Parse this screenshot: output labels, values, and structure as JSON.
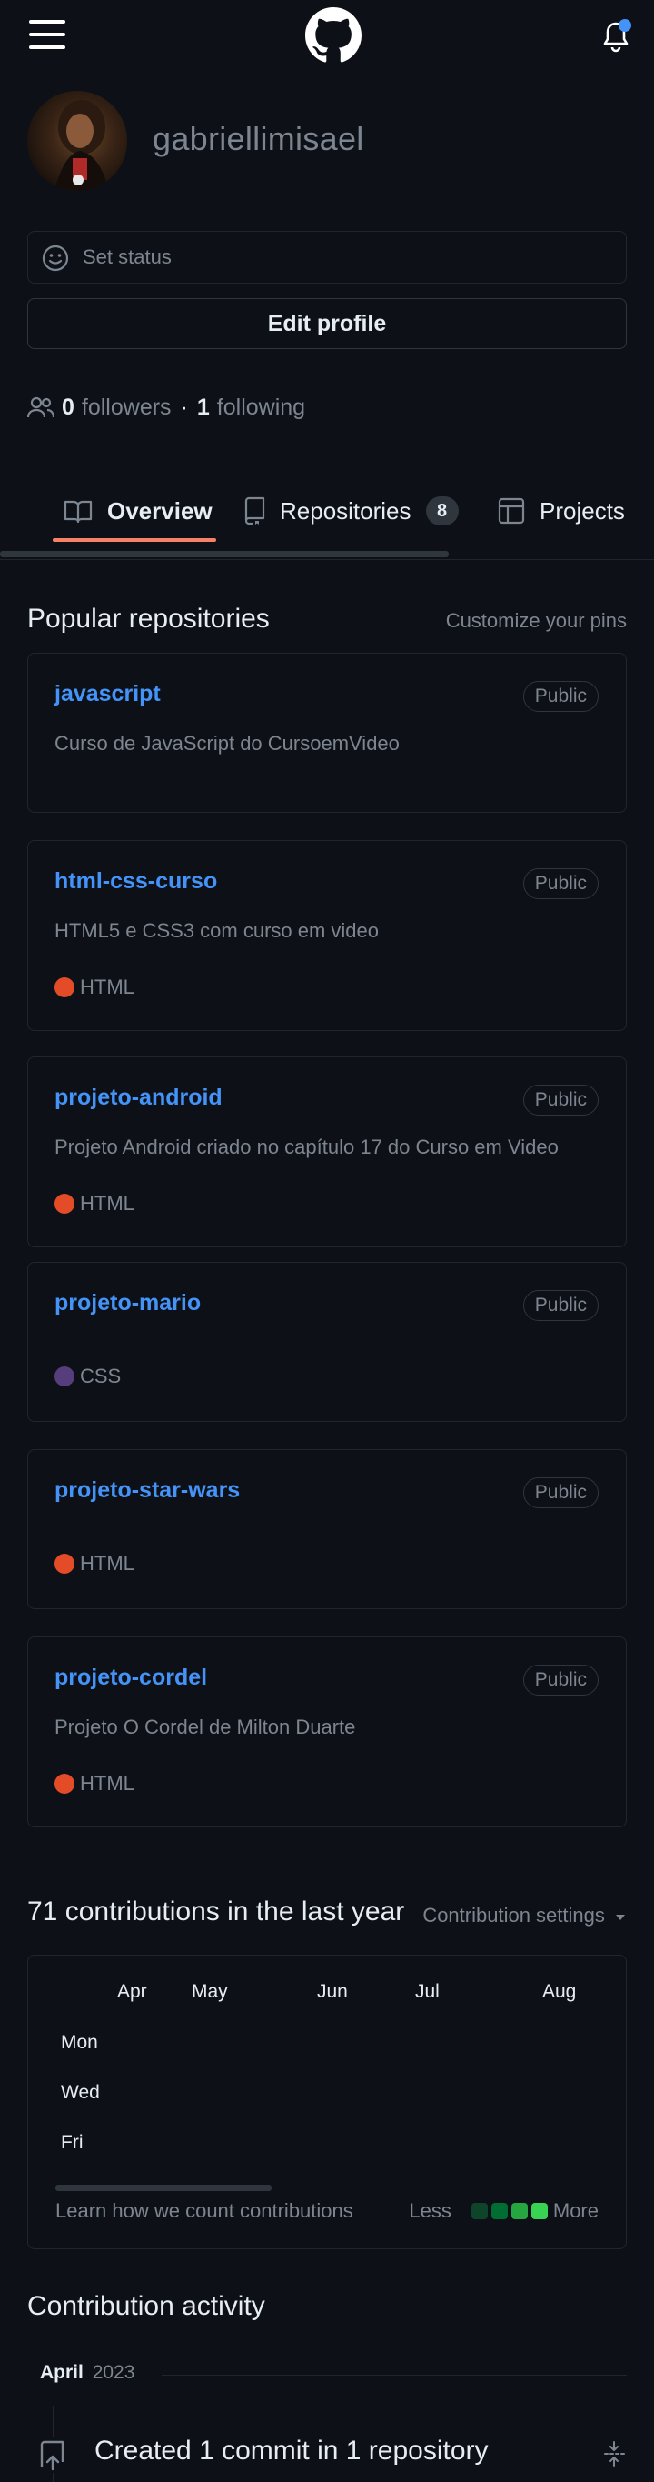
{
  "header": {
    "menu_icon": "hamburger-icon",
    "logo_icon": "github-octocat-icon",
    "notification_icon": "bell-icon",
    "notification_dot_color": "#4493f8"
  },
  "profile": {
    "username": "gabriellimisael",
    "status_placeholder": "Set status",
    "edit_button": "Edit profile",
    "followers_count": "0",
    "followers_label": "followers",
    "separator": "·",
    "following_count": "1",
    "following_label": "following"
  },
  "tabs": [
    {
      "label": "Overview",
      "icon": "book-icon",
      "selected": true
    },
    {
      "label": "Repositories",
      "icon": "repo-icon",
      "count": "8"
    },
    {
      "label": "Projects",
      "icon": "table-icon"
    }
  ],
  "popular": {
    "title": "Popular repositories",
    "customize": "Customize your pins",
    "repos": [
      {
        "name": "javascript",
        "visibility": "Public",
        "description": "Curso de JavaScript do CursoemVideo",
        "language": ""
      },
      {
        "name": "html-css-curso",
        "visibility": "Public",
        "description": "HTML5 e CSS3 com curso em video",
        "language": "HTML"
      },
      {
        "name": "projeto-android",
        "visibility": "Public",
        "description": "Projeto Android criado no capítulo 17 do Curso em Video",
        "language": "HTML"
      },
      {
        "name": "projeto-mario",
        "visibility": "Public",
        "description": "",
        "language": "CSS"
      },
      {
        "name": "projeto-star-wars",
        "visibility": "Public",
        "description": "",
        "language": "HTML"
      },
      {
        "name": "projeto-cordel",
        "visibility": "Public",
        "description": "Projeto O Cordel de Milton Duarte",
        "language": "HTML"
      }
    ],
    "language_colors": {
      "HTML": "#e34c26",
      "CSS": "#563d7c"
    }
  },
  "contributions": {
    "title": "71 contributions in the last year",
    "settings": "Contribution settings",
    "months": [
      "Apr",
      "May",
      "Jun",
      "Jul",
      "Aug"
    ],
    "days": [
      "Mon",
      "Wed",
      "Fri"
    ],
    "learn": "Learn how we count contributions",
    "less": "Less",
    "more": "More",
    "legend_colors": [
      "#0e4429",
      "#006d32",
      "#26a641",
      "#39d353"
    ]
  },
  "activity": {
    "title": "Contribution activity",
    "month": "April",
    "year": "2023",
    "event": "Created 1 commit in 1 repository",
    "event_icon": "repo-push-icon",
    "fold_icon": "fold-icon"
  }
}
